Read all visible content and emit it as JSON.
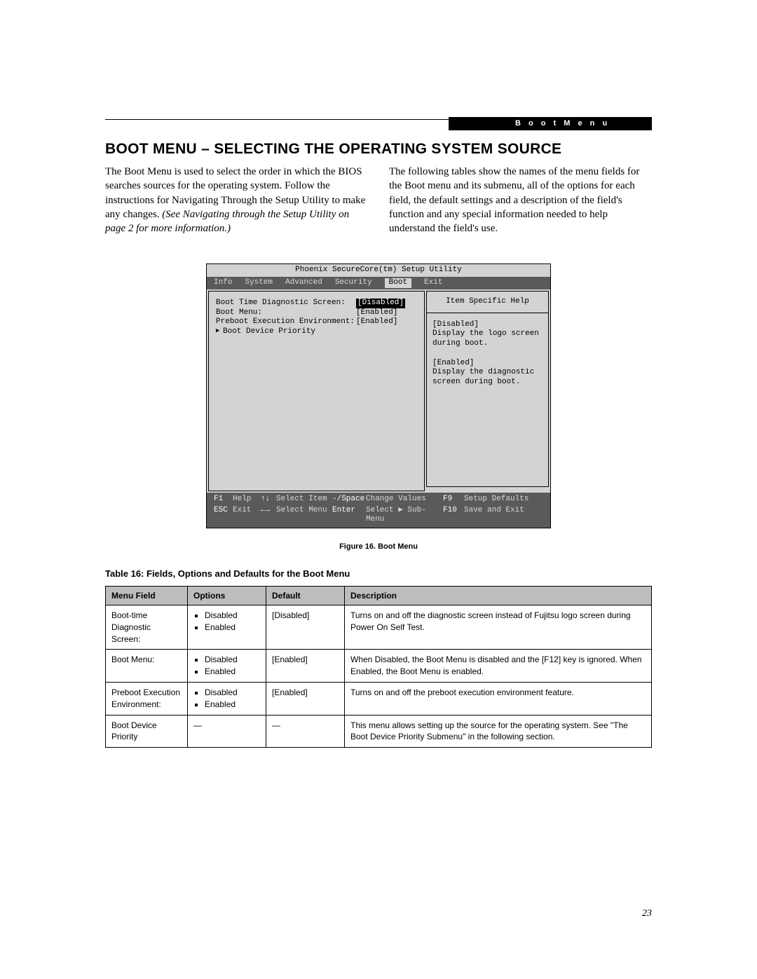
{
  "header_bar": "B o o t   M e n u",
  "section_heading": "BOOT MENU – SELECTING THE OPERATING SYSTEM SOURCE",
  "body": {
    "left_1": "The Boot Menu is used to select the order in which the BIOS searches sources for the operating system. Follow the instructions for Navigating Through the Setup Utility to make any changes. ",
    "left_italic": "(See Navigating through the Setup Utility on page 2 for more information.)",
    "right": "The following tables show the names of the menu fields for the Boot menu and its submenu, all of the options for each field, the default settings and a description of the field's function and any special information needed to help understand the field's use."
  },
  "bios": {
    "title": "Phoenix SecureCore(tm) Setup Utility",
    "tabs": [
      "Info",
      "System",
      "Advanced",
      "Security",
      "Boot",
      "Exit"
    ],
    "active_tab": "Boot",
    "rows": [
      {
        "label": "Boot Time Diagnostic Screen:",
        "value": "[Disabled]",
        "selected": true
      },
      {
        "label": "Boot Menu:",
        "value": "[Enabled]",
        "selected": false
      },
      {
        "label": "Preboot Execution Environment:",
        "value": "[Enabled]",
        "selected": false
      }
    ],
    "submenu_label": "Boot Device Priority",
    "help_title": "Item Specific Help",
    "help_body_1": "[Disabled]",
    "help_body_2": "Display the logo screen during boot.",
    "help_body_3": "[Enabled]",
    "help_body_4": "Display the diagnostic screen during boot.",
    "footer": {
      "f1": "F1",
      "help": "Help",
      "updown": "↑↓",
      "select_item": "Select Item",
      "slashspace": "-/Space",
      "change_values": "Change Values",
      "f9": "F9",
      "setup_defaults": "Setup Defaults",
      "esc": "ESC",
      "exit": "Exit",
      "leftright": "←→",
      "select_menu": "Select Menu",
      "enter": "Enter",
      "select_sub": "Select ▶ Sub-Menu",
      "f10": "F10",
      "save_exit": "Save and Exit"
    }
  },
  "figure_caption": "Figure 16.  Boot Menu",
  "table_title": "Table 16: Fields, Options and Defaults for the Boot Menu",
  "table": {
    "headers": [
      "Menu Field",
      "Options",
      "Default",
      "Description"
    ],
    "rows": [
      {
        "field": "Boot-time Diagnostic Screen:",
        "options": [
          "Disabled",
          "Enabled"
        ],
        "default": "[Disabled]",
        "description": "Turns on and off the diagnostic screen instead of Fujitsu logo screen during Power On Self Test."
      },
      {
        "field": "Boot Menu:",
        "options": [
          "Disabled",
          "Enabled"
        ],
        "default": "[Enabled]",
        "description": "When Disabled, the Boot Menu is disabled and the [F12] key is ignored. When Enabled, the Boot Menu is enabled."
      },
      {
        "field": "Preboot Execution Environment:",
        "options": [
          "Disabled",
          "Enabled"
        ],
        "default": "[Enabled]",
        "description": "Turns on and off the preboot execution environment feature."
      },
      {
        "field": "Boot Device Priority",
        "options": [],
        "options_dash": "—",
        "default": "—",
        "description": "This menu allows setting up the source for the operating system. See \"The Boot Device Priority Submenu\" in the following section."
      }
    ]
  },
  "page_number": "23"
}
